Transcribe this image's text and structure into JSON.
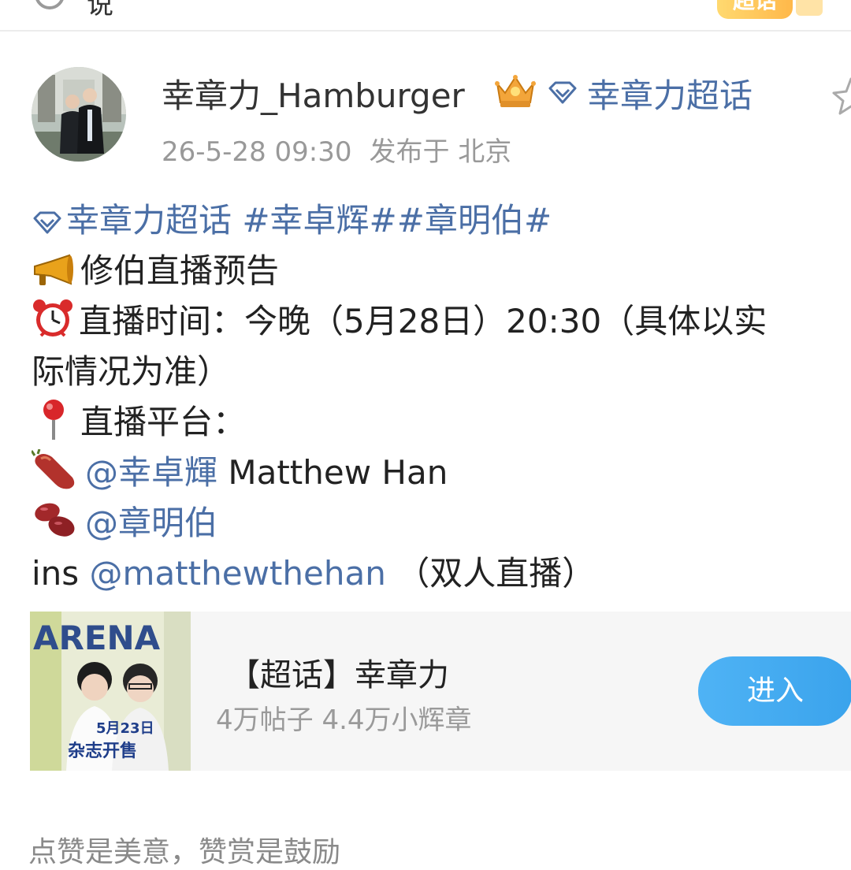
{
  "topbar": {
    "left_text": "说",
    "badge": "超话"
  },
  "post": {
    "author": "幸章力_Hamburger",
    "topic_link": "幸章力超话",
    "time": "26-5-28 09:30",
    "location": "发布于 北京",
    "line1": {
      "topic": "幸章力超话",
      "hashtags": " #幸卓辉##章明伯#"
    },
    "line2": "修伯直播预告",
    "line3": "直播时间：今晚（5月28日）20:30（具体以实",
    "line4": "际情况为准）",
    "line5": "直播平台：",
    "line6": {
      "mention": "@幸卓輝",
      "text": " Matthew Han"
    },
    "line7": {
      "mention": "@章明伯"
    },
    "line8": {
      "prefix": "ins ",
      "mention": "@matthewthehan",
      "suffix": " （双人直播）"
    }
  },
  "card": {
    "image_text": {
      "brand": "ARENA",
      "date": "5月23日",
      "caption": "杂志开售"
    },
    "title": "【超话】幸章力",
    "stats": "4万帖子 4.4万小辉章",
    "button": "进入"
  },
  "bottom_text": "点赞是美意，赞赏是鼓励",
  "colors": {
    "link": "#4b6fa6",
    "button": "#3aa3ec",
    "meta": "#999999",
    "card_bg": "#f6f6f6"
  }
}
